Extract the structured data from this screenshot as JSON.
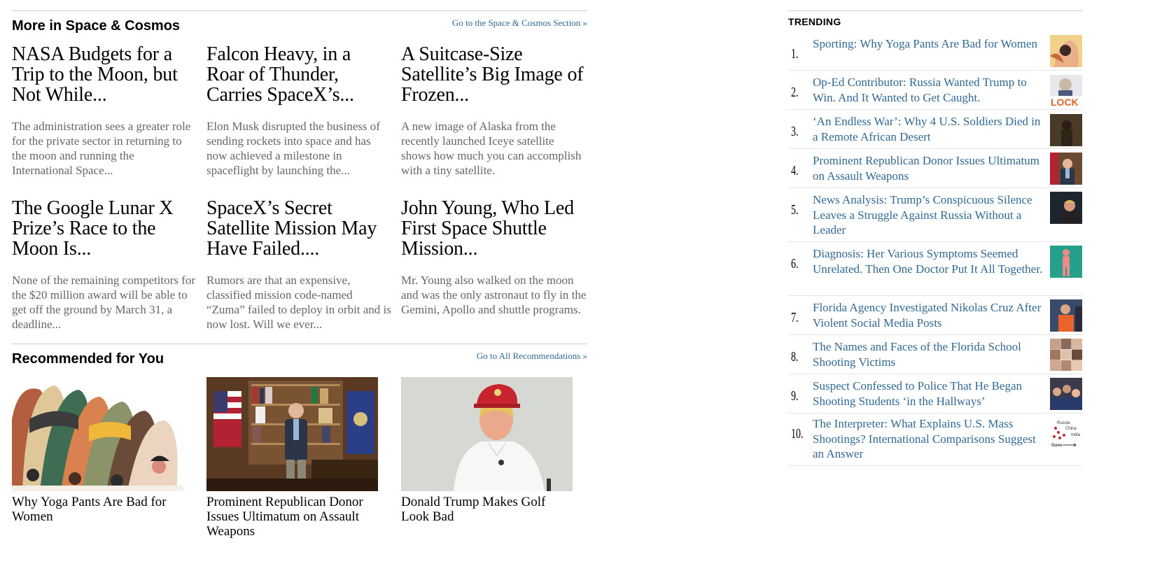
{
  "space_section": {
    "title": "More in Space & Cosmos",
    "link": "Go to the Space & Cosmos Section »",
    "stories": [
      {
        "headline": "NASA Budgets for a Trip to the Moon, but Not While...",
        "summary": "The administration sees a greater role for the private sector in returning to the moon and running the International Space..."
      },
      {
        "headline": "Falcon Heavy, in a Roar of Thunder, Carries SpaceX’s...",
        "summary": "Elon Musk disrupted the business of sending rockets into space and has now achieved a milestone in spaceflight by launching the..."
      },
      {
        "headline": "A Suitcase-Size Satellite’s Big Image of Frozen...",
        "summary": "A new image of Alaska from the recently launched Iceye satellite shows how much you can accomplish with a tiny satellite."
      },
      {
        "headline": "The Google Lunar X Prize’s Race to the Moon Is...",
        "summary": "None of the remaining competitors for the $20 million award will be able to get off the ground by March 31, a deadline..."
      },
      {
        "headline": "SpaceX’s Secret Satellite Mission May Have Failed....",
        "summary": "Rumors are that an expensive, classified mission code-named “Zuma” failed to deploy in orbit and is now lost. Will we ever..."
      },
      {
        "headline": "John Young, Who Led First Space Shuttle Mission...",
        "summary": "Mr. Young also walked on the moon and was the only astronaut to fly in the Gemini, Apollo and shuttle programs."
      }
    ]
  },
  "recommended": {
    "title": "Recommended for You",
    "link": "Go to All Recommendations »",
    "items": [
      {
        "title": "Why Yoga Pants Are Bad for Women",
        "image": "yoga-illustration"
      },
      {
        "title": "Prominent Republican Donor Issues Ultimatum on Assault Weapons",
        "image": "donor-in-office-photo"
      },
      {
        "title": "Donald Trump Makes Golf Look Bad",
        "image": "trump-golf-photo"
      }
    ]
  },
  "trending": {
    "title": "TRENDING",
    "items": [
      {
        "rank": "1.",
        "title": "Sporting: Why Yoga Pants Are Bad for Women",
        "thumb": "yoga-thumb"
      },
      {
        "rank": "2.",
        "title": "Op-Ed Contributor: Russia Wanted Trump to Win. And It Wanted to Get Caught.",
        "thumb": "lock-sign-thumb",
        "thumb_text": "LOCK"
      },
      {
        "rank": "3.",
        "title": "‘An Endless War’: Why 4 U.S. Soldiers Died in a Remote African Desert",
        "thumb": "soldier-thumb"
      },
      {
        "rank": "4.",
        "title": "Prominent Republican Donor Issues Ultimatum on Assault Weapons",
        "thumb": "donor-thumb"
      },
      {
        "rank": "5.",
        "title": "News Analysis: Trump’s Conspicuous Silence Leaves a Struggle Against Russia Without a Leader",
        "thumb": "trump-thumb"
      },
      {
        "rank": "6.",
        "title": "Diagnosis: Her Various Symptoms Seemed Unrelated. Then One Doctor Put It All Together.",
        "thumb": "body-illustration-thumb"
      },
      {
        "rank": "7.",
        "title": "Florida Agency Investigated Nikolas Cruz After Violent Social Media Posts",
        "thumb": "suspect-thumb"
      },
      {
        "rank": "8.",
        "title": "The Names and Faces of the Florida School Shooting Victims",
        "thumb": "victims-grid-thumb"
      },
      {
        "rank": "9.",
        "title": "Suspect Confessed to Police That He Began Shooting Students ‘in the Hallways’",
        "thumb": "crowd-thumb"
      },
      {
        "rank": "10.",
        "title": "The Interpreter: What Explains U.S. Mass Shootings? International Comparisons Suggest an Answer",
        "thumb": "chart-thumb",
        "thumb_labels": [
          "Russia",
          "China",
          "India",
          "Guns"
        ]
      }
    ]
  },
  "colors": {
    "link": "#326891",
    "headline": "#000000",
    "summary": "#666666",
    "rule": "#cccccc"
  }
}
